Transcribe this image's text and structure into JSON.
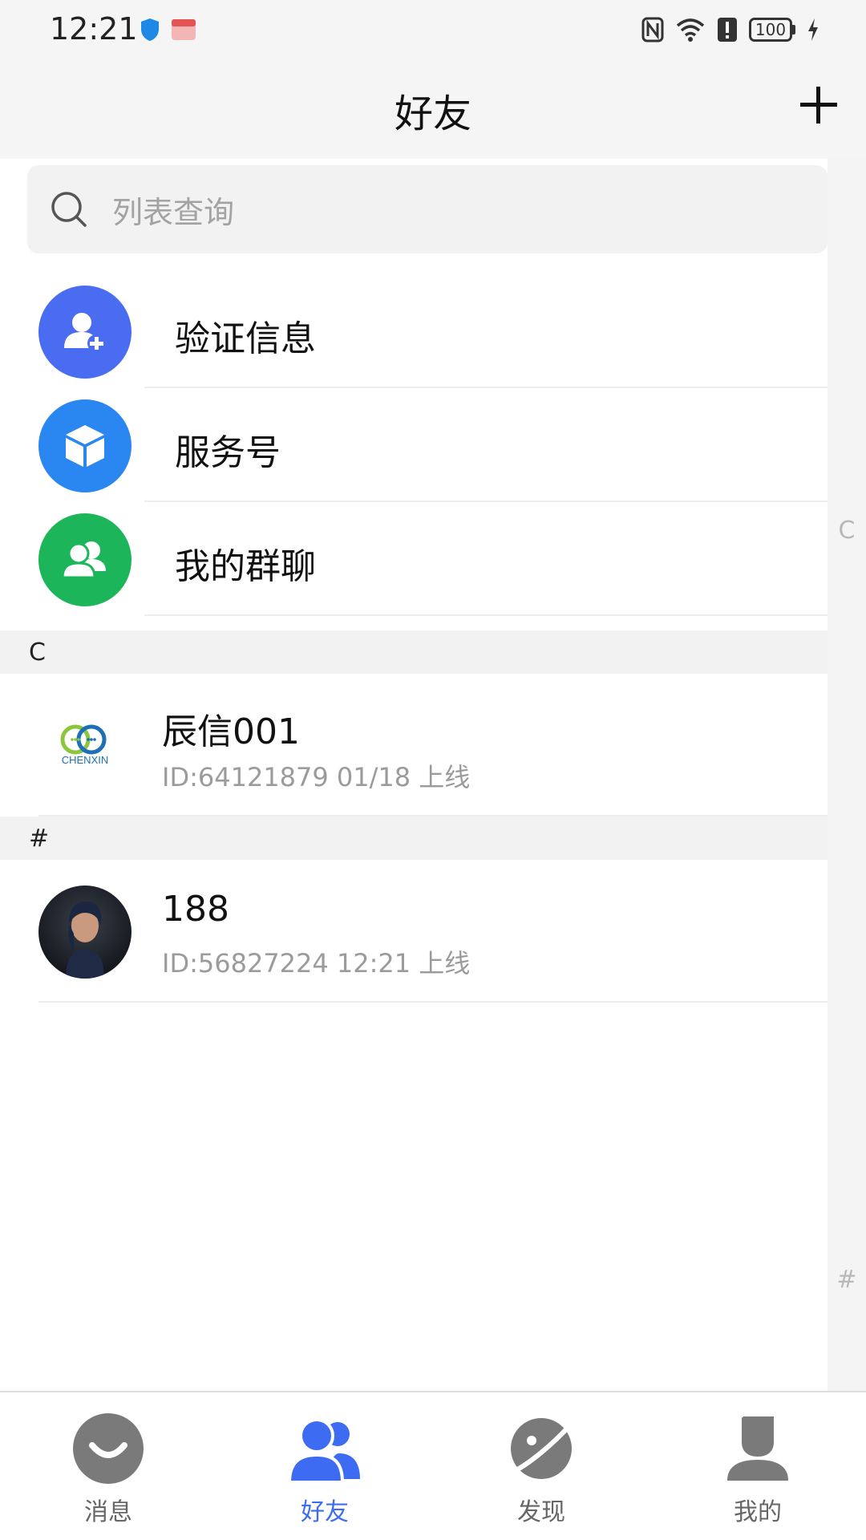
{
  "status_bar": {
    "time": "12:21",
    "battery": "100"
  },
  "header": {
    "title": "好友"
  },
  "search": {
    "placeholder": "列表查询"
  },
  "features": [
    {
      "label": "验证信息",
      "icon": "user-add-icon",
      "color": "#4a6cf0"
    },
    {
      "label": "服务号",
      "icon": "cube-icon",
      "color": "#2a86f0"
    },
    {
      "label": "我的群聊",
      "icon": "group-icon",
      "color": "#1db55a"
    }
  ],
  "sections": [
    {
      "letter": "C",
      "contacts": [
        {
          "name": "辰信001",
          "meta": "ID:64121879  01/18 上线",
          "logo_text": "CHENXIN"
        }
      ]
    },
    {
      "letter": "#",
      "contacts": [
        {
          "name": "188",
          "meta": "ID:56827224  12:21 上线"
        }
      ]
    }
  ],
  "index_rail": [
    "C",
    "#"
  ],
  "bottom_nav": [
    {
      "label": "消息",
      "icon": "message-icon",
      "active": false
    },
    {
      "label": "好友",
      "icon": "friends-icon",
      "active": true
    },
    {
      "label": "发现",
      "icon": "planet-icon",
      "active": false
    },
    {
      "label": "我的",
      "icon": "profile-icon",
      "active": false
    }
  ],
  "colors": {
    "accent": "#3d6cf2",
    "inactive_nav": "#7a7a7a"
  }
}
